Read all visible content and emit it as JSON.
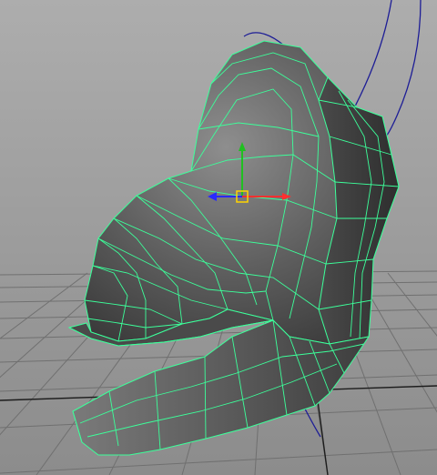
{
  "viewport": {
    "background_top": "#a9a9a9",
    "background_bottom": "#8a8a8a",
    "grid_color": "#6e6e6e",
    "grid_axis_color": "#1a1a1a",
    "wire_color": "#3cff9a",
    "mesh_face_dark": "#3b3b3b",
    "mesh_face_light": "#8c8c8c",
    "curve_color": "#1a1a9a"
  },
  "manipulator": {
    "x_axis_color": "#ff3030",
    "y_axis_color": "#20c020",
    "z_axis_color": "#2a2aff",
    "center_color": "#ffd400",
    "icon": "move-manipulator-icon"
  }
}
